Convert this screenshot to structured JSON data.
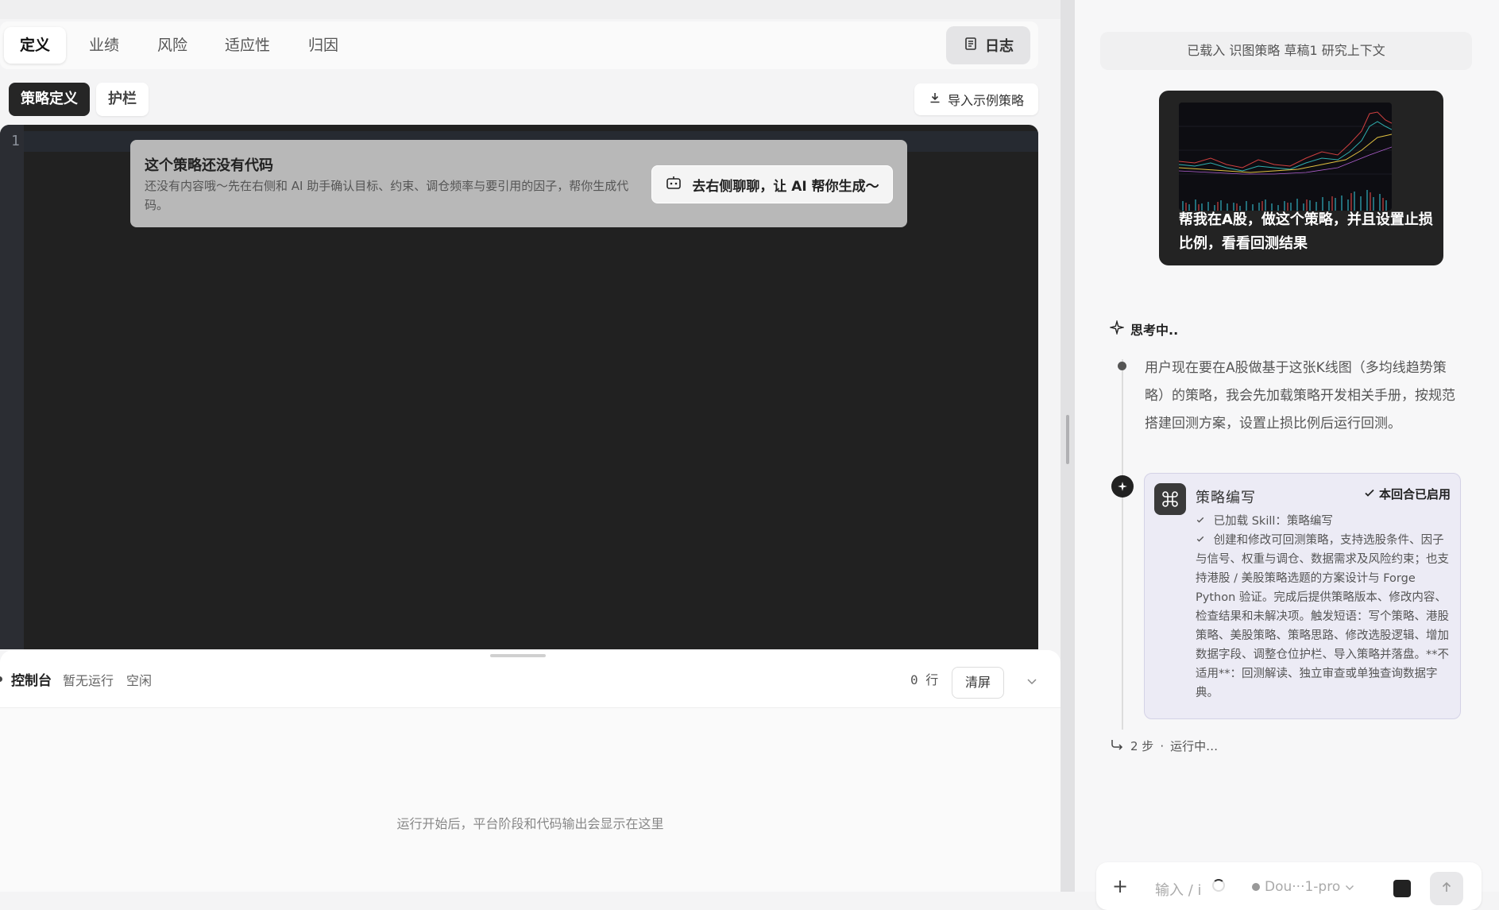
{
  "tabs": [
    {
      "label": "定义",
      "active": true
    },
    {
      "label": "业绩",
      "active": false
    },
    {
      "label": "风险",
      "active": false
    },
    {
      "label": "适应性",
      "active": false
    },
    {
      "label": "归因",
      "active": false
    }
  ],
  "log_button": {
    "label": "日志",
    "icon": "log-icon"
  },
  "subtabs": [
    {
      "label": "策略定义",
      "active": true
    },
    {
      "label": "护栏",
      "active": false
    }
  ],
  "import_button": {
    "label": "导入示例策略",
    "icon": "download-icon"
  },
  "editor": {
    "line_number": "1",
    "empty_state": {
      "title": "这个策略还没有代码",
      "description": "还没有内容哦～先在右侧和 AI 助手确认目标、约束、调仓频率与要引用的因子，帮你生成代码。",
      "button_label": "去右侧聊聊，让 AI 帮你生成～",
      "button_icon": "robot-icon"
    }
  },
  "console": {
    "title": "控制台",
    "status_run": "暂无运行",
    "status_idle": "空闲",
    "line_count": "0 行",
    "clear_label": "清屏",
    "empty_message": "运行开始后，平台阶段和代码输出会显示在这里"
  },
  "chat": {
    "context_banner": "已载入 识图策略 草稿1 研究上下文",
    "user_message": "帮我在A股，做这个策略，并且设置止损比例，看看回测结果",
    "thinking_label": "思考中..",
    "thought_text": "用户现在要在A股做基于这张K线图（多均线趋势策略）的策略，我会先加载策略开发相关手册，按规范搭建回测方案，设置止损比例后运行回测。",
    "skill": {
      "title": "策略编写",
      "badge": "本回合已启用",
      "loaded": "已加载 Skill：策略编写",
      "description": "创建和修改可回测策略，支持选股条件、因子与信号、权重与调仓、数据需求及风险约束；也支持港股 / 美股策略选题的方案设计与 Forge Python 验证。完成后提供策略版本、修改内容、检查结果和未解决项。触发短语：写个策略、港股策略、美股策略、策略思路、修改选股逻辑、增加数据字段、调整仓位护栏、导入策略并落盘。**不适用**：回测解读、独立审查或单独查询数据字典。"
    },
    "steps": "2 步",
    "running": "运行中…",
    "input": {
      "placeholder": "输入 / i",
      "model": "Dou···1-pro"
    }
  },
  "colors": {
    "editor_bg": "#212121",
    "accent_dark": "#262626",
    "skill_bg": "#ecebf5"
  }
}
